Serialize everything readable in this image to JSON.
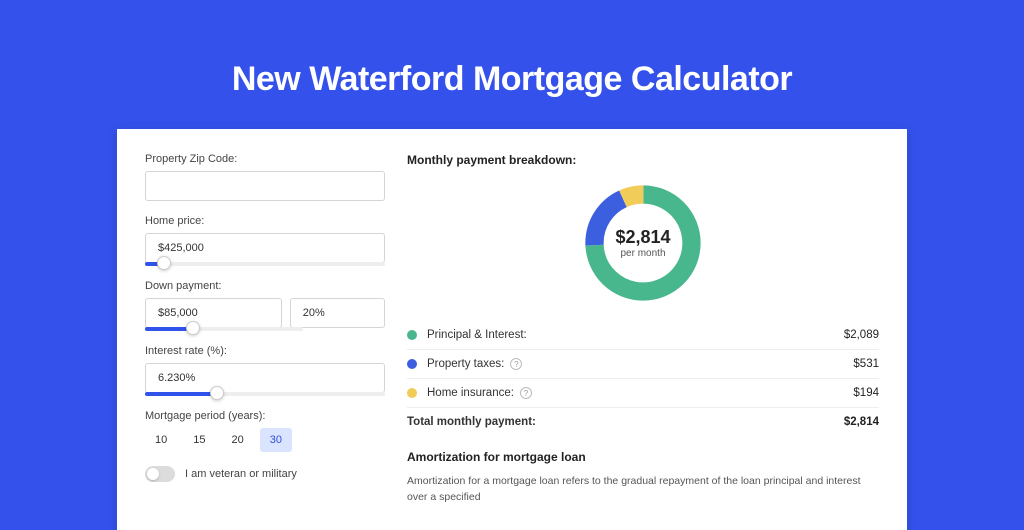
{
  "title": "New Waterford Mortgage Calculator",
  "form": {
    "zip_label": "Property Zip Code:",
    "zip_value": "",
    "price_label": "Home price:",
    "price_value": "$425,000",
    "price_slider_pct": 8,
    "down_label": "Down payment:",
    "down_value": "$85,000",
    "down_pct": "20%",
    "down_slider_pct": 20,
    "rate_label": "Interest rate (%):",
    "rate_value": "6.230%",
    "rate_slider_pct": 30,
    "period_label": "Mortgage period (years):",
    "periods": [
      "10",
      "15",
      "20",
      "30"
    ],
    "period_active_index": 3,
    "veteran_label": "I am veteran or military"
  },
  "breakdown": {
    "title": "Monthly payment breakdown:",
    "center_value": "$2,814",
    "center_sub": "per month",
    "items": [
      {
        "label": "Principal & Interest:",
        "value": "$2,089",
        "color": "#49b78e",
        "info": false
      },
      {
        "label": "Property taxes:",
        "value": "$531",
        "color": "#3c5fe0",
        "info": true
      },
      {
        "label": "Home insurance:",
        "value": "$194",
        "color": "#f2cc58",
        "info": true
      }
    ],
    "total_label": "Total monthly payment:",
    "total_value": "$2,814"
  },
  "amort": {
    "title": "Amortization for mortgage loan",
    "text": "Amortization for a mortgage loan refers to the gradual repayment of the loan principal and interest over a specified"
  },
  "chart_data": {
    "type": "pie",
    "title": "Monthly payment breakdown",
    "series": [
      {
        "name": "Principal & Interest",
        "value": 2089,
        "color": "#49b78e"
      },
      {
        "name": "Property taxes",
        "value": 531,
        "color": "#3c5fe0"
      },
      {
        "name": "Home insurance",
        "value": 194,
        "color": "#f2cc58"
      }
    ],
    "total": 2814,
    "center_label": "$2,814 per month"
  }
}
